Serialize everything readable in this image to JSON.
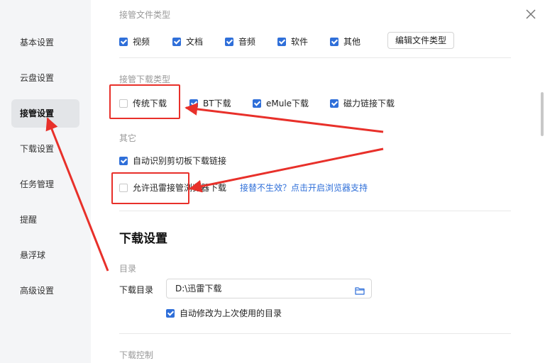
{
  "sidebar": {
    "items": [
      {
        "label": "基本设置",
        "active": false
      },
      {
        "label": "云盘设置",
        "active": false
      },
      {
        "label": "接管设置",
        "active": true
      },
      {
        "label": "下载设置",
        "active": false
      },
      {
        "label": "任务管理",
        "active": false
      },
      {
        "label": "提醒",
        "active": false
      },
      {
        "label": "悬浮球",
        "active": false
      },
      {
        "label": "高级设置",
        "active": false
      }
    ]
  },
  "file_types": {
    "title": "接管文件类型",
    "options": [
      {
        "label": "视频",
        "checked": true
      },
      {
        "label": "文档",
        "checked": true
      },
      {
        "label": "音频",
        "checked": true
      },
      {
        "label": "软件",
        "checked": true
      },
      {
        "label": "其他",
        "checked": true
      }
    ],
    "edit_button": "编辑文件类型"
  },
  "download_types": {
    "title": "接管下载类型",
    "options": [
      {
        "label": "传统下载",
        "checked": false
      },
      {
        "label": "BT下载",
        "checked": true
      },
      {
        "label": "eMule下载",
        "checked": true
      },
      {
        "label": "磁力链接下载",
        "checked": true
      }
    ]
  },
  "other": {
    "title": "其它",
    "clipboard": {
      "label": "自动识别剪切板下载链接",
      "checked": true
    },
    "browser": {
      "label": "允许迅雷接管浏览器下载",
      "checked": false
    },
    "browser_link": "接替不生效？点击开启浏览器支持"
  },
  "download_settings": {
    "heading": "下载设置",
    "dir_section": "目录",
    "dir_label": "下载目录",
    "dir_value": "D:\\迅雷下载",
    "auto_modify": {
      "label": "自动修改为上次使用的目录",
      "checked": true
    },
    "control_section": "下载控制"
  },
  "colors": {
    "accent": "#2f6fd9",
    "annotation": "#e8302a"
  },
  "icons": {
    "close": "close-icon",
    "folder": "folder-icon"
  }
}
